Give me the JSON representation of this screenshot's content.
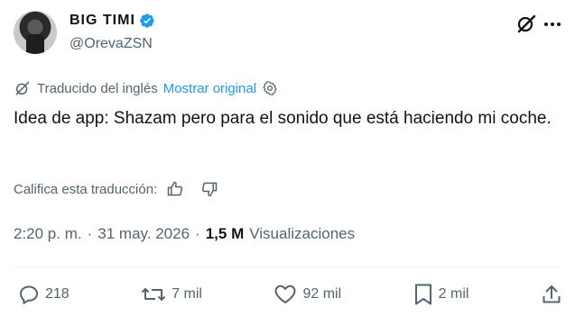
{
  "author": {
    "name": "BIG TIMI",
    "handle": "@OrevaZSN"
  },
  "translation": {
    "label": "Traducido del inglés",
    "show_original": "Mostrar original"
  },
  "tweet": {
    "text": "Idea de app: Shazam pero para el sonido que está haciendo mi coche."
  },
  "rating": {
    "label": "Califica esta traducción:"
  },
  "meta": {
    "time": "2:20 p. m.",
    "sep1": "·",
    "date": "31 may. 2026",
    "sep2": "·",
    "views_count": "1,5 M",
    "views_label": "Visualizaciones"
  },
  "actions": {
    "replies": "218",
    "reposts": "7 mil",
    "likes": "92 mil",
    "bookmarks": "2 mil"
  },
  "colors": {
    "accent": "#1d9bf0",
    "text": "#0f1419",
    "muted": "#536471"
  }
}
